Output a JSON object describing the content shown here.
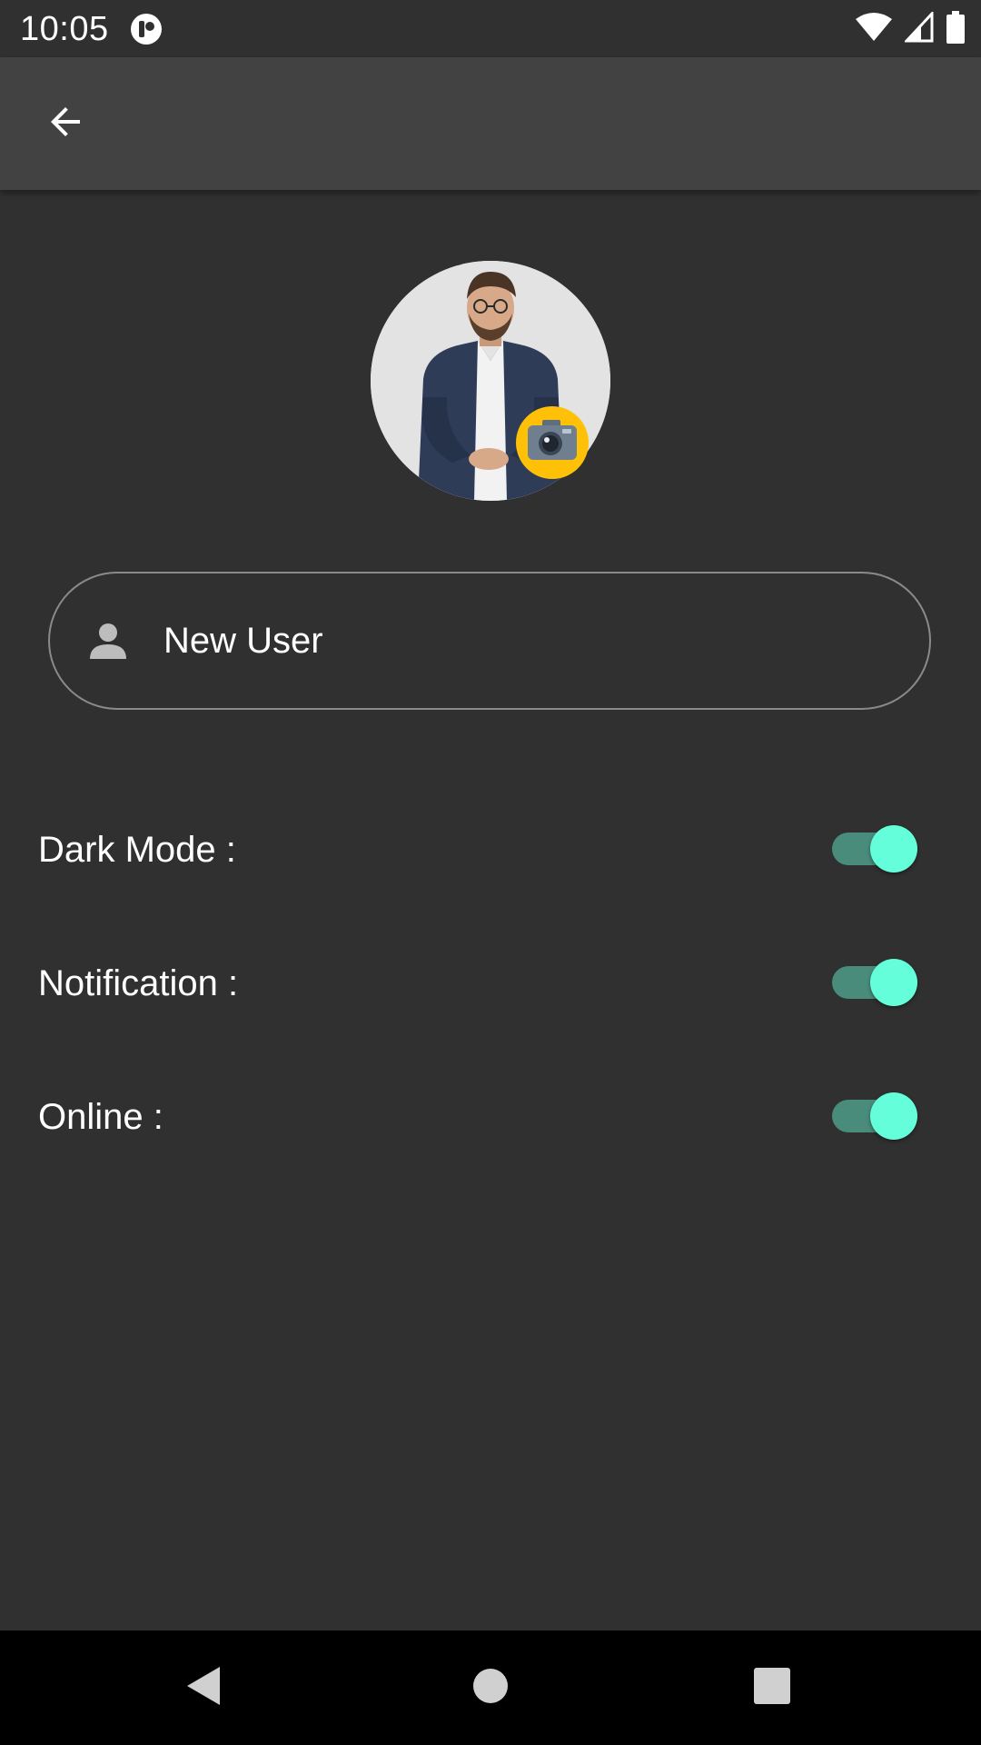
{
  "status_bar": {
    "time": "10:05",
    "icons": [
      "app-notification-icon",
      "wifi-icon",
      "cellular-signal-icon",
      "battery-icon"
    ]
  },
  "app_bar": {
    "back_icon": "arrow-back-icon"
  },
  "profile": {
    "avatar_icon": "profile-photo",
    "camera_icon": "camera-icon"
  },
  "name_field": {
    "icon": "person-icon",
    "value": "New User"
  },
  "settings": [
    {
      "label": "Dark Mode :",
      "enabled": true
    },
    {
      "label": "Notification :",
      "enabled": true
    },
    {
      "label": "Online :",
      "enabled": true
    }
  ],
  "nav_bar": {
    "icons": [
      "back-triangle-icon",
      "home-circle-icon",
      "recents-square-icon"
    ]
  },
  "colors": {
    "background": "#303030",
    "app_bar": "#424242",
    "accent": "#64ffda",
    "toggle_track": "#4a8c7c",
    "camera_badge": "#ffc107"
  }
}
